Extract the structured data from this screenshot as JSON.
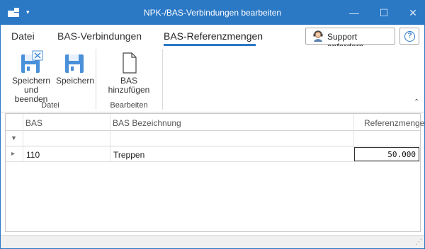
{
  "window": {
    "title": "NPK-/BAS-Verbindungen bearbeiten",
    "controls": {
      "minimize": "—",
      "maximize": "☐",
      "close": "✕"
    },
    "quick_access_chevron": "▾"
  },
  "ribbon_tabs": [
    {
      "label": "Datei",
      "active": false
    },
    {
      "label": "BAS-Verbindungen",
      "active": false
    },
    {
      "label": "BAS-Referenzmengen",
      "active": true
    }
  ],
  "support_button": {
    "label": "Support anfordern"
  },
  "help_button": {
    "label": "?"
  },
  "ribbon": {
    "groups": [
      {
        "label": "Datei",
        "buttons": [
          {
            "label_line1": "Speichern",
            "label_line2": "und beenden",
            "icon": "save-close-icon"
          },
          {
            "label_line1": "Speichern",
            "label_line2": "",
            "icon": "save-icon"
          }
        ]
      },
      {
        "label": "Bearbeiten",
        "buttons": [
          {
            "label_line1": "BAS hinzufügen",
            "label_line2": "",
            "icon": "new-document-icon"
          }
        ]
      }
    ],
    "collapse_glyph": "⌃"
  },
  "grid": {
    "columns": [
      "BAS",
      "BAS Bezeichnung",
      "Referenzmenge"
    ],
    "filter_glyph": "▼",
    "row_indicator": "▸",
    "rows": [
      {
        "bas": "110",
        "bezeichnung": "Treppen",
        "referenzmenge": "50.000"
      }
    ]
  },
  "statusbar": {
    "grip": "⋰"
  },
  "colors": {
    "accent": "#2b78c5",
    "title_text": "#ffffff",
    "border": "#c8c8c8"
  }
}
